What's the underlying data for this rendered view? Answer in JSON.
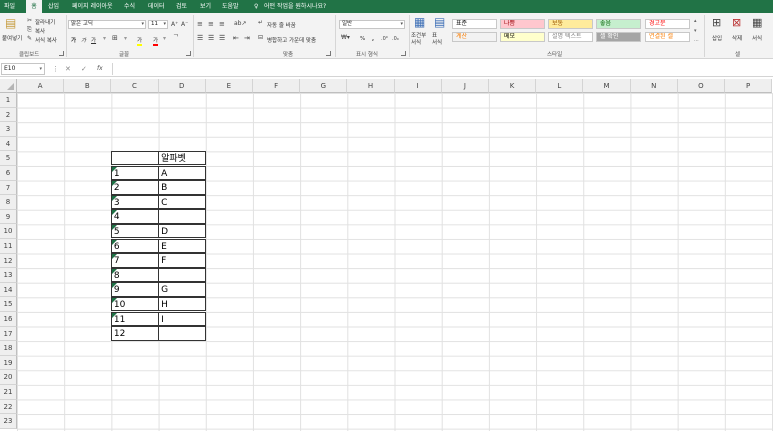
{
  "menu": {
    "tabs": [
      "파일",
      "홈",
      "삽입",
      "페이지 레이아웃",
      "수식",
      "데이터",
      "검토",
      "보기",
      "도움말"
    ],
    "tell_me": "어떤 작업을 원하시나요?"
  },
  "clipboard": {
    "paste": "붙여넣기",
    "cut": "잘라내기",
    "copy": "복사",
    "format_painter": "서식 복사",
    "label": "클립보드"
  },
  "font": {
    "name": "맑은 고딕",
    "size": "11",
    "bold": "가",
    "italic": "가",
    "underline": "가",
    "font_color": "가",
    "fill": "가",
    "label": "글꼴"
  },
  "alignment": {
    "wrap": "자동 줄 바꿈",
    "merge": "병합하고 가운데 맞춤",
    "label": "맞춤"
  },
  "number": {
    "format": "일반",
    "percent": "%",
    "comma": ",",
    "label": "표시 형식"
  },
  "styles_group": {
    "conditional": "조건부\n서식",
    "table": "표\n서식",
    "label": "스타일",
    "items": [
      {
        "name": "표준",
        "bg": "#ffffff",
        "fg": "#000000"
      },
      {
        "name": "나쁨",
        "bg": "#ffc7ce",
        "fg": "#9c0006"
      },
      {
        "name": "보통",
        "bg": "#ffeb9c",
        "fg": "#9c5700"
      },
      {
        "name": "좋음",
        "bg": "#c6efce",
        "fg": "#006100"
      },
      {
        "name": "경고문",
        "bg": "#ffffff",
        "fg": "#ff0000"
      },
      {
        "name": "계산",
        "bg": "#f2f2f2",
        "fg": "#fa7d00"
      },
      {
        "name": "메모",
        "bg": "#ffffcc",
        "fg": "#000000"
      },
      {
        "name": "설명 텍스트",
        "bg": "#ffffff",
        "fg": "#7f7f7f"
      },
      {
        "name": "셀 확인",
        "bg": "#a5a5a5",
        "fg": "#ffffff"
      },
      {
        "name": "연결된 셀",
        "bg": "#ffffff",
        "fg": "#fa7d00"
      }
    ]
  },
  "cells_group": {
    "insert": "삽입",
    "delete": "삭제",
    "format": "서식",
    "label": "셀"
  },
  "formula_bar": {
    "name_box": "E10",
    "fx": "fx"
  },
  "columns": [
    "A",
    "B",
    "C",
    "D",
    "E",
    "F",
    "G",
    "H",
    "I",
    "J",
    "K",
    "L",
    "M",
    "N",
    "O",
    "P"
  ],
  "rows": [
    "1",
    "2",
    "3",
    "4",
    "5",
    "6",
    "7",
    "8",
    "9",
    "10",
    "11",
    "12",
    "13",
    "14",
    "15",
    "16",
    "17",
    "18",
    "19",
    "20",
    "21",
    "22",
    "23"
  ],
  "table": {
    "header_d": "알파벳",
    "c": [
      "1",
      "2",
      "3",
      "4",
      "5",
      "6",
      "7",
      "8",
      "9",
      "10",
      "11",
      "12"
    ],
    "d": [
      "A",
      "B",
      "C",
      "",
      "D",
      "E",
      "F",
      "",
      "G",
      "H",
      "I",
      ""
    ]
  }
}
